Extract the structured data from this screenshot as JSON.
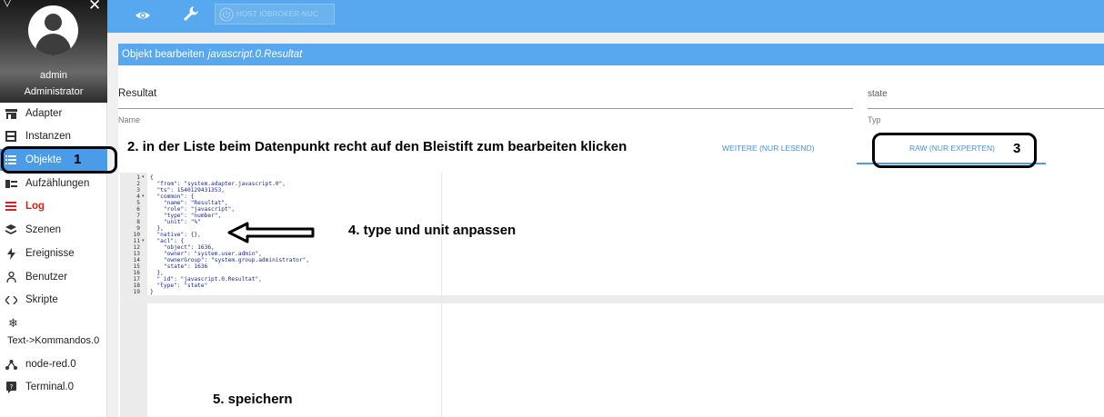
{
  "sidebar": {
    "username": "admin",
    "role": "Administrator",
    "items": [
      {
        "label": "Adapter",
        "icon": "adapter-icon"
      },
      {
        "label": "Instanzen",
        "icon": "instances-icon"
      },
      {
        "label": "Objekte",
        "icon": "list-icon"
      },
      {
        "label": "Aufzählungen",
        "icon": "enum-icon"
      },
      {
        "label": "Log",
        "icon": "log-icon"
      },
      {
        "label": "Szenen",
        "icon": "scenes-icon"
      },
      {
        "label": "Ereignisse",
        "icon": "bolt-icon"
      },
      {
        "label": "Benutzer",
        "icon": "user-icon"
      },
      {
        "label": "Skripte",
        "icon": "code-icon"
      },
      {
        "label": "Text->Kommandos.0",
        "icon": "snowflake-icon"
      },
      {
        "label": "node-red.0",
        "icon": "node-red-icon"
      },
      {
        "label": "Terminal.0",
        "icon": "terminal-icon"
      }
    ]
  },
  "topbar": {
    "host_label": "HOST IOBROKER-NUC"
  },
  "dialog": {
    "title_prefix": "Objekt bearbeiten",
    "title_object": "javascript.0.Resultat",
    "name_value": "Resultat",
    "name_label": "Name",
    "type_value": "state",
    "type_label": "Typ",
    "tab_weitere": "WEITERE (NUR LESEND)",
    "tab_raw": "RAW (NUR EXPERTEN)"
  },
  "editor": {
    "lines": [
      {
        "n": "1",
        "fold": true,
        "text": "{"
      },
      {
        "n": "2",
        "fold": false,
        "text": "  \"from\": \"system.adapter.javascript.0\","
      },
      {
        "n": "3",
        "fold": false,
        "text": "  \"ts\": 1540129431353,"
      },
      {
        "n": "4",
        "fold": true,
        "text": "  \"common\": {"
      },
      {
        "n": "5",
        "fold": false,
        "text": "    \"name\": \"Resultat\","
      },
      {
        "n": "6",
        "fold": false,
        "text": "    \"role\": \"javascript\","
      },
      {
        "n": "7",
        "fold": false,
        "text": "    \"type\": \"number\","
      },
      {
        "n": "8",
        "fold": false,
        "text": "    \"unit\": \"%\""
      },
      {
        "n": "9",
        "fold": false,
        "text": "  },"
      },
      {
        "n": "10",
        "fold": false,
        "text": "  \"native\": {},"
      },
      {
        "n": "11",
        "fold": true,
        "text": "  \"acl\": {"
      },
      {
        "n": "12",
        "fold": false,
        "text": "    \"object\": 1636,"
      },
      {
        "n": "13",
        "fold": false,
        "text": "    \"owner\": \"system.user.admin\","
      },
      {
        "n": "14",
        "fold": false,
        "text": "    \"ownerGroup\": \"system.group.administrator\","
      },
      {
        "n": "15",
        "fold": false,
        "text": "    \"state\": 1636"
      },
      {
        "n": "16",
        "fold": false,
        "text": "  },"
      },
      {
        "n": "17",
        "fold": false,
        "text": "  \"_id\": \"javascript.0.Resultat\","
      },
      {
        "n": "18",
        "fold": false,
        "text": "  \"type\": \"state\""
      },
      {
        "n": "19",
        "fold": false,
        "text": "}"
      }
    ]
  },
  "annotations": {
    "step1": "1",
    "step2": "2. in der Liste beim Datenpunkt recht auf den Bleistift zum bearbeiten klicken",
    "step3": "3",
    "step4": "4. type und unit anpassen",
    "step5": "5. speichern"
  },
  "colors": {
    "accent": "#57a8ee",
    "active_nav": "#4a9ce8",
    "log_red": "#d9201a"
  }
}
